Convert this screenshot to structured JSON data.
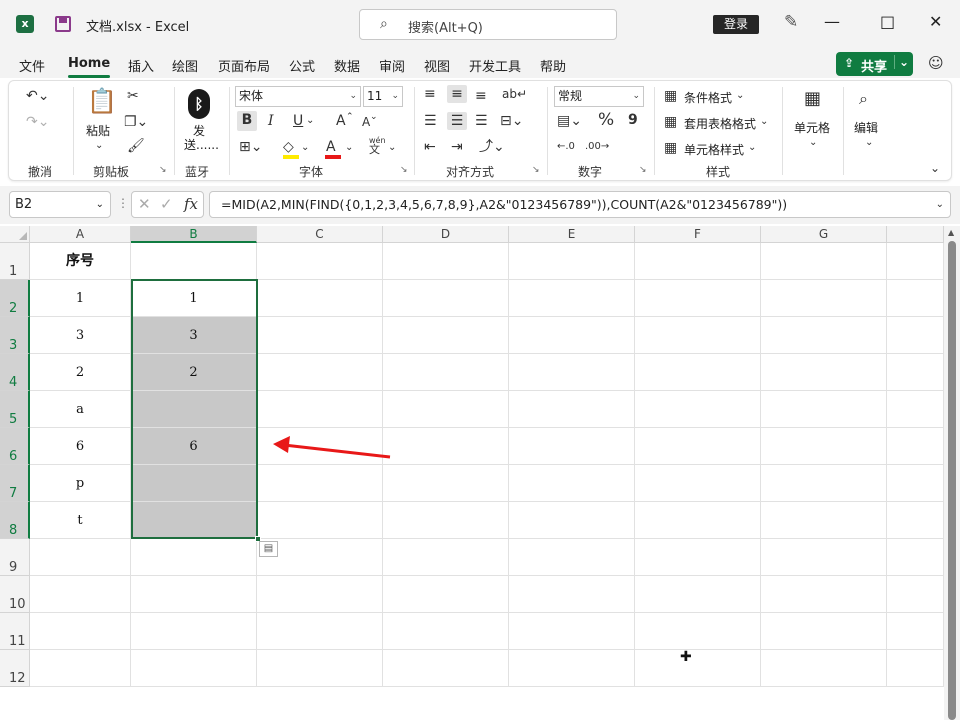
{
  "titlebar": {
    "app_icon": "excel-icon",
    "title": "文档.xlsx  -  Excel",
    "search_placeholder": "搜索(Alt+Q)",
    "login": "登录"
  },
  "menu": {
    "items": [
      "文件",
      "Home",
      "插入",
      "绘图",
      "页面布局",
      "公式",
      "数据",
      "审阅",
      "视图",
      "开发工具",
      "帮助"
    ],
    "active": "Home",
    "share": "共享"
  },
  "ribbon": {
    "groups": {
      "undo": "撤消",
      "clipboard": "剪贴板",
      "bluetooth": "蓝牙",
      "font": "字体",
      "align": "对齐方式",
      "number": "数字",
      "styles": "样式"
    },
    "paste": "粘贴",
    "send": "发\n送......",
    "send_line1": "发",
    "send_line2": "送......",
    "font_name": "宋体",
    "font_size": "11",
    "number_format": "常规",
    "conditional": "条件格式",
    "table_format": "套用表格格式",
    "cell_style": "单元格样式",
    "cells": "单元格",
    "edit": "编辑",
    "bold": "B",
    "italic": "I",
    "underline": "U",
    "grow_font": "A",
    "shrink_font": "A",
    "font_color": "A",
    "percent": "%",
    "comma": "9",
    "phonetic_top": "wén",
    "phonetic_bottom": "文"
  },
  "formula_bar": {
    "name_box": "B2",
    "fx": "fx",
    "formula": "=MID(A2,MIN(FIND({0,1,2,3,4,5,6,7,8,9},A2&\"0123456789\")),COUNT(A2&\"0123456789\"))"
  },
  "grid": {
    "columns": [
      "A",
      "B",
      "C",
      "D",
      "E",
      "F",
      "G"
    ],
    "selected_column": "B",
    "rows": [
      "1",
      "2",
      "3",
      "4",
      "5",
      "6",
      "7",
      "8",
      "9",
      "10",
      "11",
      "12"
    ],
    "col_a": [
      "序号",
      "1",
      "3",
      "2",
      "a",
      "6",
      "p",
      "t"
    ],
    "col_b": [
      "",
      "1",
      "3",
      "2",
      "",
      "6",
      "",
      ""
    ]
  },
  "colors": {
    "accent": "#107c41",
    "selection": "#c8c8c8",
    "arrow": "#e81818"
  }
}
